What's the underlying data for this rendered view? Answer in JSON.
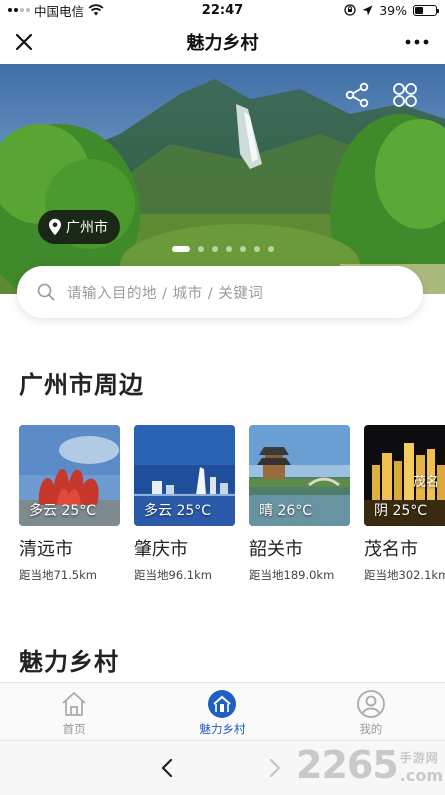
{
  "status_bar": {
    "carrier": "中国电信",
    "time": "22:47",
    "battery": "39%",
    "battery_level": 0.39
  },
  "nav": {
    "title": "魅力乡村"
  },
  "hero": {
    "location": "广州市",
    "slides": 7,
    "active_slide": 0
  },
  "search": {
    "placeholder": "请输入目的地 / 城市 / 关键词"
  },
  "nearby": {
    "title": "广州市周边",
    "cities": [
      {
        "name": "清远市",
        "weather": "多云 25°C",
        "distance": "距当地71.5km"
      },
      {
        "name": "肇庆市",
        "weather": "多云 25°C",
        "distance": "距当地96.1km"
      },
      {
        "name": "韶关市",
        "weather": "晴 26°C",
        "distance": "距当地189.0km"
      },
      {
        "name": "茂名市",
        "weather": "阴 25°C",
        "distance": "距当地302.1km",
        "overlay_text": "茂名"
      }
    ]
  },
  "village": {
    "title": "魅力乡村"
  },
  "tab_bar": {
    "tabs": [
      {
        "label": "首页",
        "icon": "home-icon",
        "active": false
      },
      {
        "label": "魅力乡村",
        "icon": "village-icon",
        "active": true
      },
      {
        "label": "我的",
        "icon": "profile-icon",
        "active": false
      }
    ]
  },
  "watermark": {
    "number": "2265",
    "sub": "手游网",
    "domain": ".com"
  },
  "colors": {
    "accent": "#1f5fc5",
    "inactive": "#999999"
  }
}
